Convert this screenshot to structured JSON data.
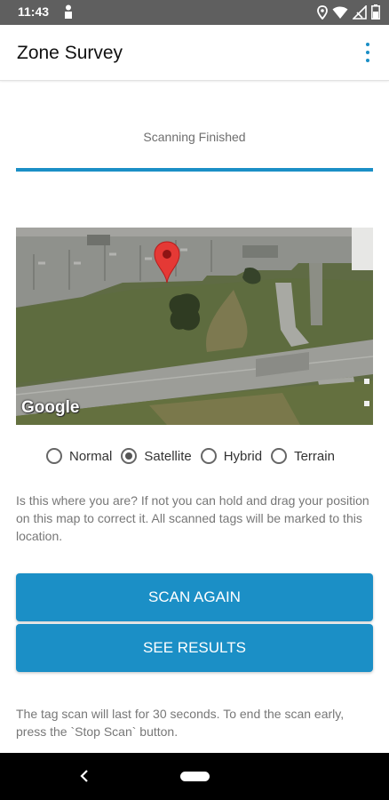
{
  "status_bar": {
    "time": "11:43"
  },
  "app_bar": {
    "title": "Zone Survey",
    "menu_icon": "more-vert-icon"
  },
  "scan": {
    "status_text": "Scanning Finished",
    "progress": 1.0
  },
  "map": {
    "attribution": "Google",
    "pin_icon": "map-pin-icon",
    "map_types": [
      {
        "label": "Normal",
        "selected": false
      },
      {
        "label": "Satellite",
        "selected": true
      },
      {
        "label": "Hybrid",
        "selected": false
      },
      {
        "label": "Terrain",
        "selected": false
      }
    ]
  },
  "help_text": "Is this where you are? If not you can hold and drag your position on this map to correct it. All scanned tags will be marked to this location.",
  "buttons": {
    "scan_again": "SCAN AGAIN",
    "see_results": "SEE RESULTS"
  },
  "footer_text": "The tag scan will last for 30 seconds. To end the scan early, press the `Stop Scan` button.",
  "colors": {
    "accent": "#1b8fc6",
    "status_bar": "#5f5f5f",
    "nav_bar": "#000000"
  }
}
